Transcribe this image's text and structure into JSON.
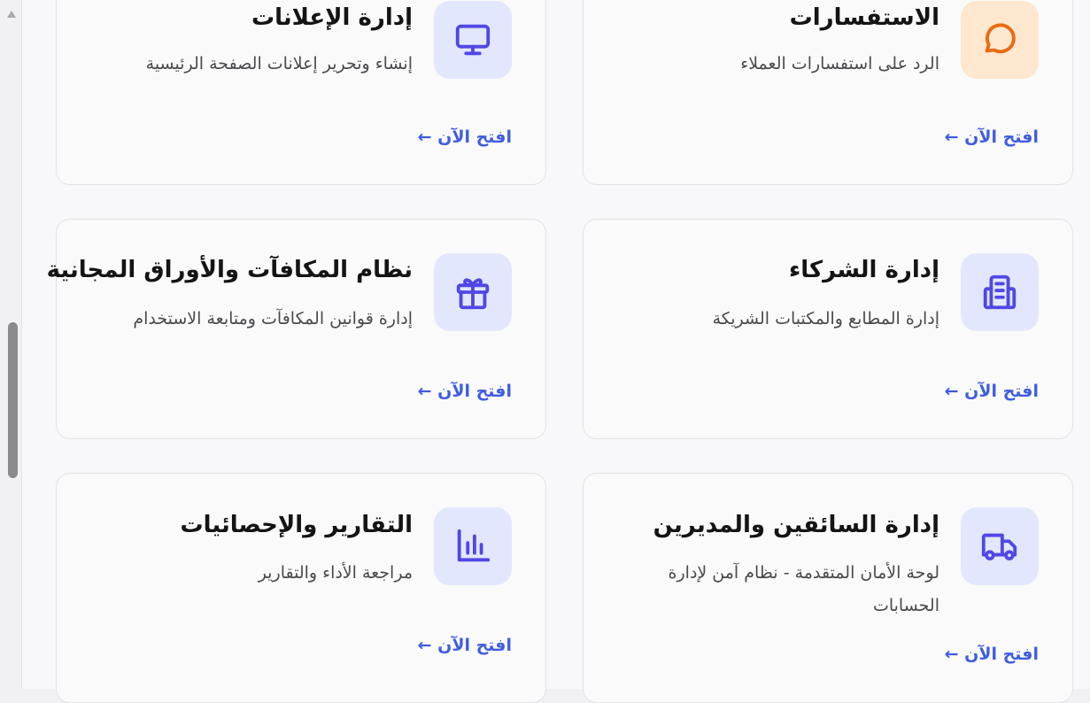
{
  "cards": [
    {
      "title": "إدارة الإعلانات",
      "description": "إنشاء وتحرير إعلانات الصفحة الرئيسية",
      "link": "افتح الآن ←",
      "icon": "monitor-icon"
    },
    {
      "title": "الاستفسارات",
      "description": "الرد على استفسارات العملاء",
      "link": "افتح الآن ←",
      "icon": "chat-bubble-icon"
    },
    {
      "title": "نظام المكافآت والأوراق المجانية",
      "description": "إدارة قوانين المكافآت ومتابعة الاستخدام",
      "link": "افتح الآن ←",
      "icon": "gift-icon"
    },
    {
      "title": "إدارة الشركاء",
      "description": "إدارة المطابع والمكتبات الشريكة",
      "link": "افتح الآن ←",
      "icon": "building-icon"
    },
    {
      "title": "التقارير والإحصائيات",
      "description": "مراجعة الأداء والتقارير",
      "link": "افتح الآن ←",
      "icon": "bar-chart-icon"
    },
    {
      "title": "إدارة السائقين والمديرين",
      "description": "لوحة الأمان المتقدمة - نظام آمن لإدارة الحسابات",
      "link": "افتح الآن ←",
      "icon": "truck-icon"
    }
  ],
  "colors": {
    "accent": "#5147e6",
    "link": "#3f5de0",
    "orange_icon": "#ea6a12",
    "icon_bg_blue": "#e3e7fe",
    "icon_bg_orange": "#ffe8cf"
  }
}
